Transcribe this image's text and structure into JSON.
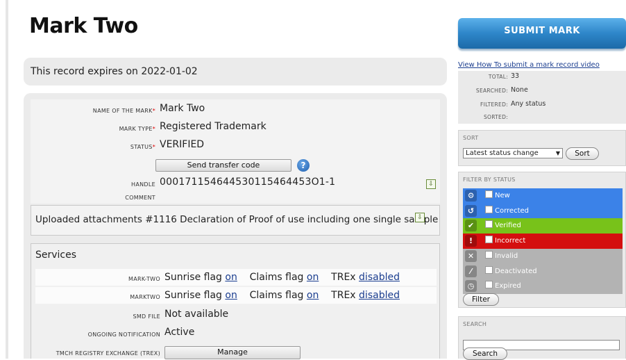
{
  "page": {
    "title": "Mark Two",
    "expiry_text": "This record expires on 2022-01-02"
  },
  "details": {
    "name_label": "Name of the mark",
    "name_value": "Mark Two",
    "type_label": "Mark type",
    "type_value": "Registered Trademark",
    "status_label": "Status",
    "status_value": "VERIFIED",
    "transfer_button": "Send transfer code",
    "help_icon_glyph": "?",
    "handle_label": "Handle",
    "handle_value": "000171154644530115464453O1-1",
    "comment_label": "Comment",
    "comment_value": ""
  },
  "attachments": {
    "text": "Uploaded attachments #1116 Declaration of Proof of use including one single sample"
  },
  "services": {
    "title": "Services",
    "rows": [
      {
        "label": "mark-two",
        "sunrise": "Sunrise flag",
        "sunrise_link": "on",
        "claims": "Claims flag",
        "claims_link": "on",
        "trex": "TREx",
        "trex_link": "disabled"
      },
      {
        "label": "marktwo",
        "sunrise": "Sunrise flag",
        "sunrise_link": "on",
        "claims": "Claims flag",
        "claims_link": "on",
        "trex": "TREx",
        "trex_link": "disabled"
      }
    ],
    "smd_label": "SMD file",
    "smd_value": "Not available",
    "notification_label": "Ongoing notification",
    "notification_value": "Active",
    "trex_label": "TMCH Registry Exchange (TREx)",
    "manage_button": "Manage"
  },
  "sidebar": {
    "submit_button": "SUBMIT MARK",
    "video_link": "View How To submit a mark record video",
    "stats": [
      {
        "key": "Total:",
        "value": "33"
      },
      {
        "key": "Searched:",
        "value": "None"
      },
      {
        "key": "Filtered:",
        "value": "Any status"
      },
      {
        "key": "Sorted:",
        "value": ""
      }
    ],
    "sort": {
      "title": "Sort",
      "selected": "Latest status change",
      "button": "Sort"
    },
    "filter": {
      "title": "Filter by status",
      "statuses": [
        {
          "label": "New",
          "color": "#3b82e8",
          "icon": "gear-icon",
          "glyph": "⚙"
        },
        {
          "label": "Corrected",
          "color": "#3b82e8",
          "icon": "undo-icon",
          "glyph": "↺"
        },
        {
          "label": "Verified",
          "color": "#78c21a",
          "icon": "check-icon",
          "glyph": "✔"
        },
        {
          "label": "Incorrect",
          "color": "#d40f0f",
          "icon": "warning-icon",
          "glyph": "!"
        },
        {
          "label": "Invalid",
          "color": "#b3b3b3",
          "icon": "x-icon",
          "glyph": "✕"
        },
        {
          "label": "Deactivated",
          "color": "#b3b3b3",
          "icon": "slash-icon",
          "glyph": "⁄"
        },
        {
          "label": "Expired",
          "color": "#b3b3b3",
          "icon": "clock-icon",
          "glyph": "◷"
        }
      ],
      "button": "Filter"
    },
    "search": {
      "title": "Search",
      "value": "",
      "button": "Search"
    }
  }
}
